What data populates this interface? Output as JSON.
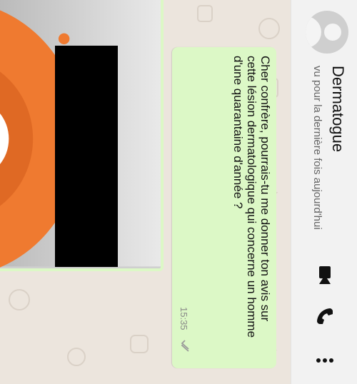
{
  "header": {
    "contact_name": "Dermatogue",
    "status": "vu pour la dernière fois aujourd'hui",
    "icons": [
      "avatar",
      "video-call-icon",
      "phone-icon",
      "more-vert-icon"
    ]
  },
  "messages": [
    {
      "type": "text",
      "text": "Cher confrère, pourrais-tu me donner ton avis sur cette lésion dermatologique qui concerne un homme d'une quarantaine d'année ?",
      "time": "15:35",
      "status_icon": "double-check-icon"
    },
    {
      "type": "image",
      "redacted": true
    }
  ],
  "colors": {
    "appbar": "#f2f2f2",
    "chat_bg": "#ece5dd",
    "bubble_out": "#dcf8c6",
    "photo_orange": "#ef7a30"
  }
}
